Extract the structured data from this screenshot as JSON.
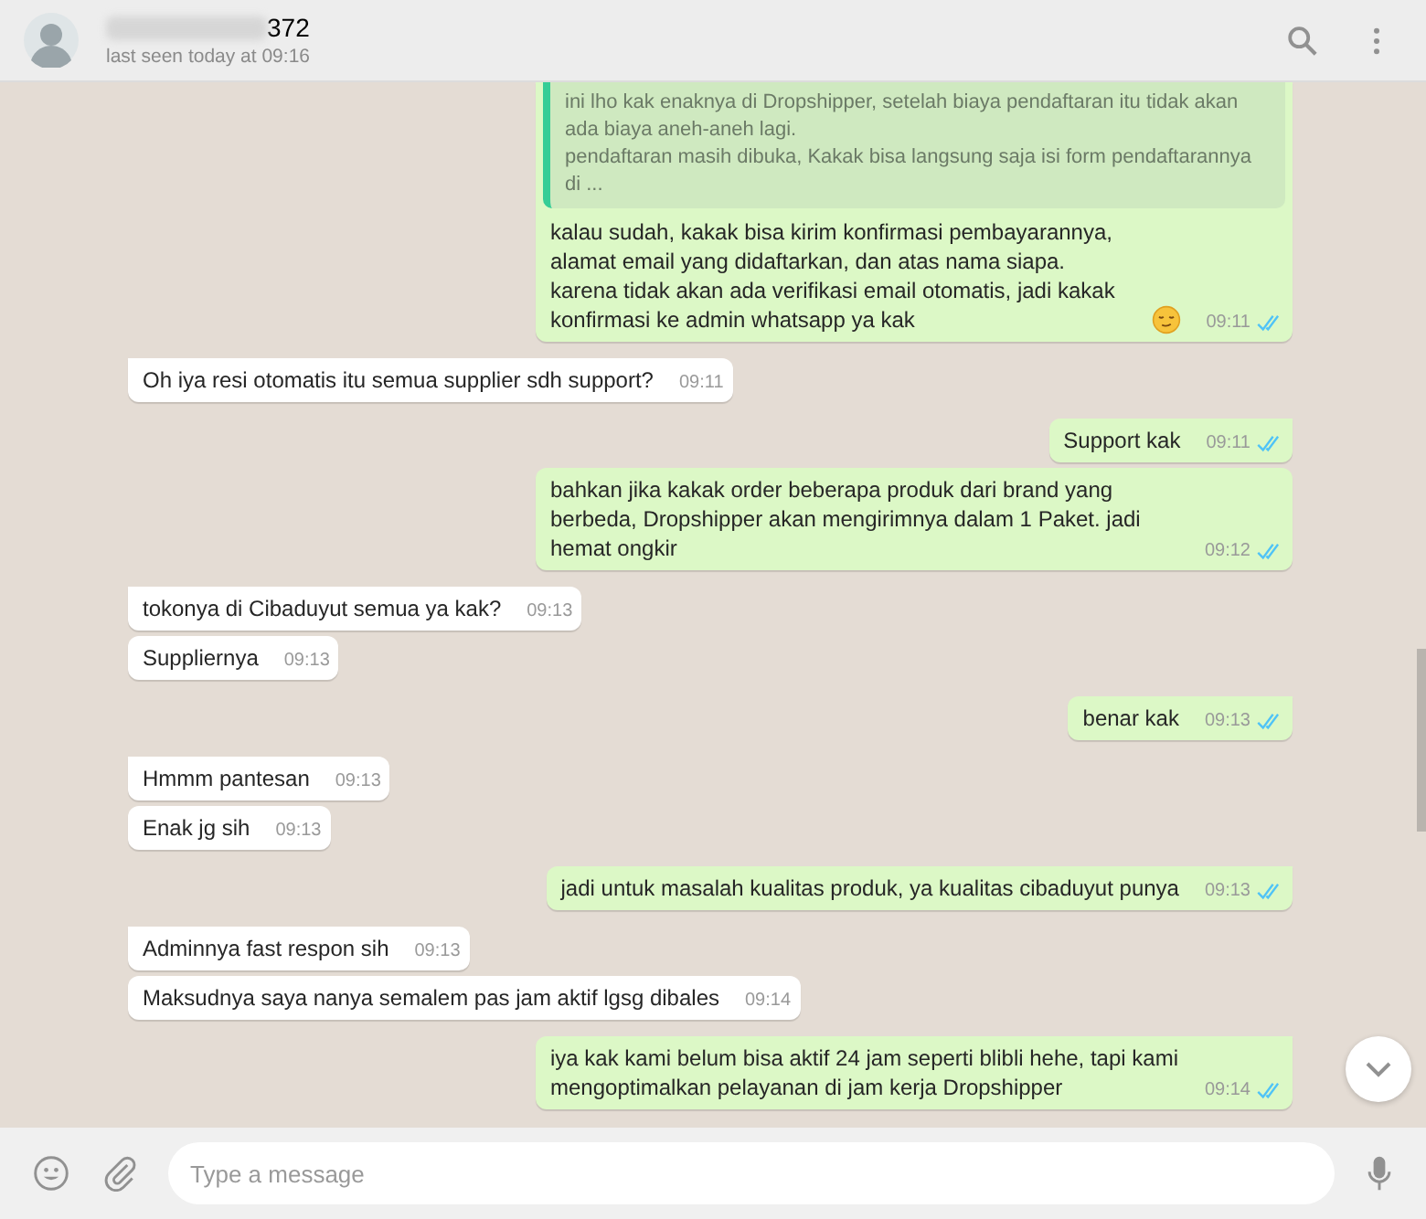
{
  "header": {
    "name": "372",
    "last_seen": "last seen today at 09:16"
  },
  "messages": [
    {
      "kind": "out",
      "tail": false,
      "quote": {
        "lines": [
          "ini lho kak enaknya di Dropshipper, setelah biaya pendaftaran itu tidak akan ada biaya aneh-aneh lagi.",
          "pendaftaran masih dibuka, Kakak bisa langsung saja isi form pendaftarannya di ..."
        ]
      },
      "text": "kalau sudah, kakak bisa kirim konfirmasi pembayarannya, alamat email yang didaftarkan, dan atas nama siapa.\nkarena tidak akan ada verifikasi email otomatis, jadi kakak konfirmasi ke admin whatsapp ya kak",
      "emoji": true,
      "time": "09:11",
      "read": true
    },
    {
      "kind": "in",
      "tail": true,
      "text": "Oh iya resi otomatis itu semua supplier sdh support?",
      "time": "09:11"
    },
    {
      "kind": "out",
      "tail": true,
      "text": "Support kak",
      "time": "09:11",
      "read": true
    },
    {
      "kind": "out",
      "tail": false,
      "text": "bahkan jika kakak order beberapa produk dari brand yang berbeda, Dropshipper akan mengirimnya dalam 1 Paket. jadi hemat ongkir",
      "time": "09:12",
      "read": true
    },
    {
      "kind": "in",
      "tail": true,
      "text": "tokonya di Cibaduyut semua ya kak?",
      "time": "09:13"
    },
    {
      "kind": "in",
      "tail": false,
      "text": "Suppliernya",
      "time": "09:13"
    },
    {
      "kind": "out",
      "tail": true,
      "text": "benar kak",
      "time": "09:13",
      "read": true
    },
    {
      "kind": "in",
      "tail": true,
      "text": "Hmmm pantesan",
      "time": "09:13"
    },
    {
      "kind": "in",
      "tail": false,
      "text": "Enak jg sih",
      "time": "09:13"
    },
    {
      "kind": "out",
      "tail": true,
      "text": "jadi untuk masalah kualitas produk, ya kualitas cibaduyut punya",
      "time": "09:13",
      "read": true
    },
    {
      "kind": "in",
      "tail": true,
      "text": "Adminnya fast respon sih",
      "time": "09:13"
    },
    {
      "kind": "in",
      "tail": false,
      "text": "Maksudnya saya nanya semalem pas jam aktif lgsg dibales",
      "time": "09:14"
    },
    {
      "kind": "out",
      "tail": true,
      "text": "iya kak kami belum bisa aktif 24 jam seperti blibli hehe, tapi kami mengoptimalkan pelayanan di jam kerja Dropshipper",
      "time": "09:14",
      "read": true
    }
  ],
  "composer": {
    "placeholder": "Type a message"
  }
}
